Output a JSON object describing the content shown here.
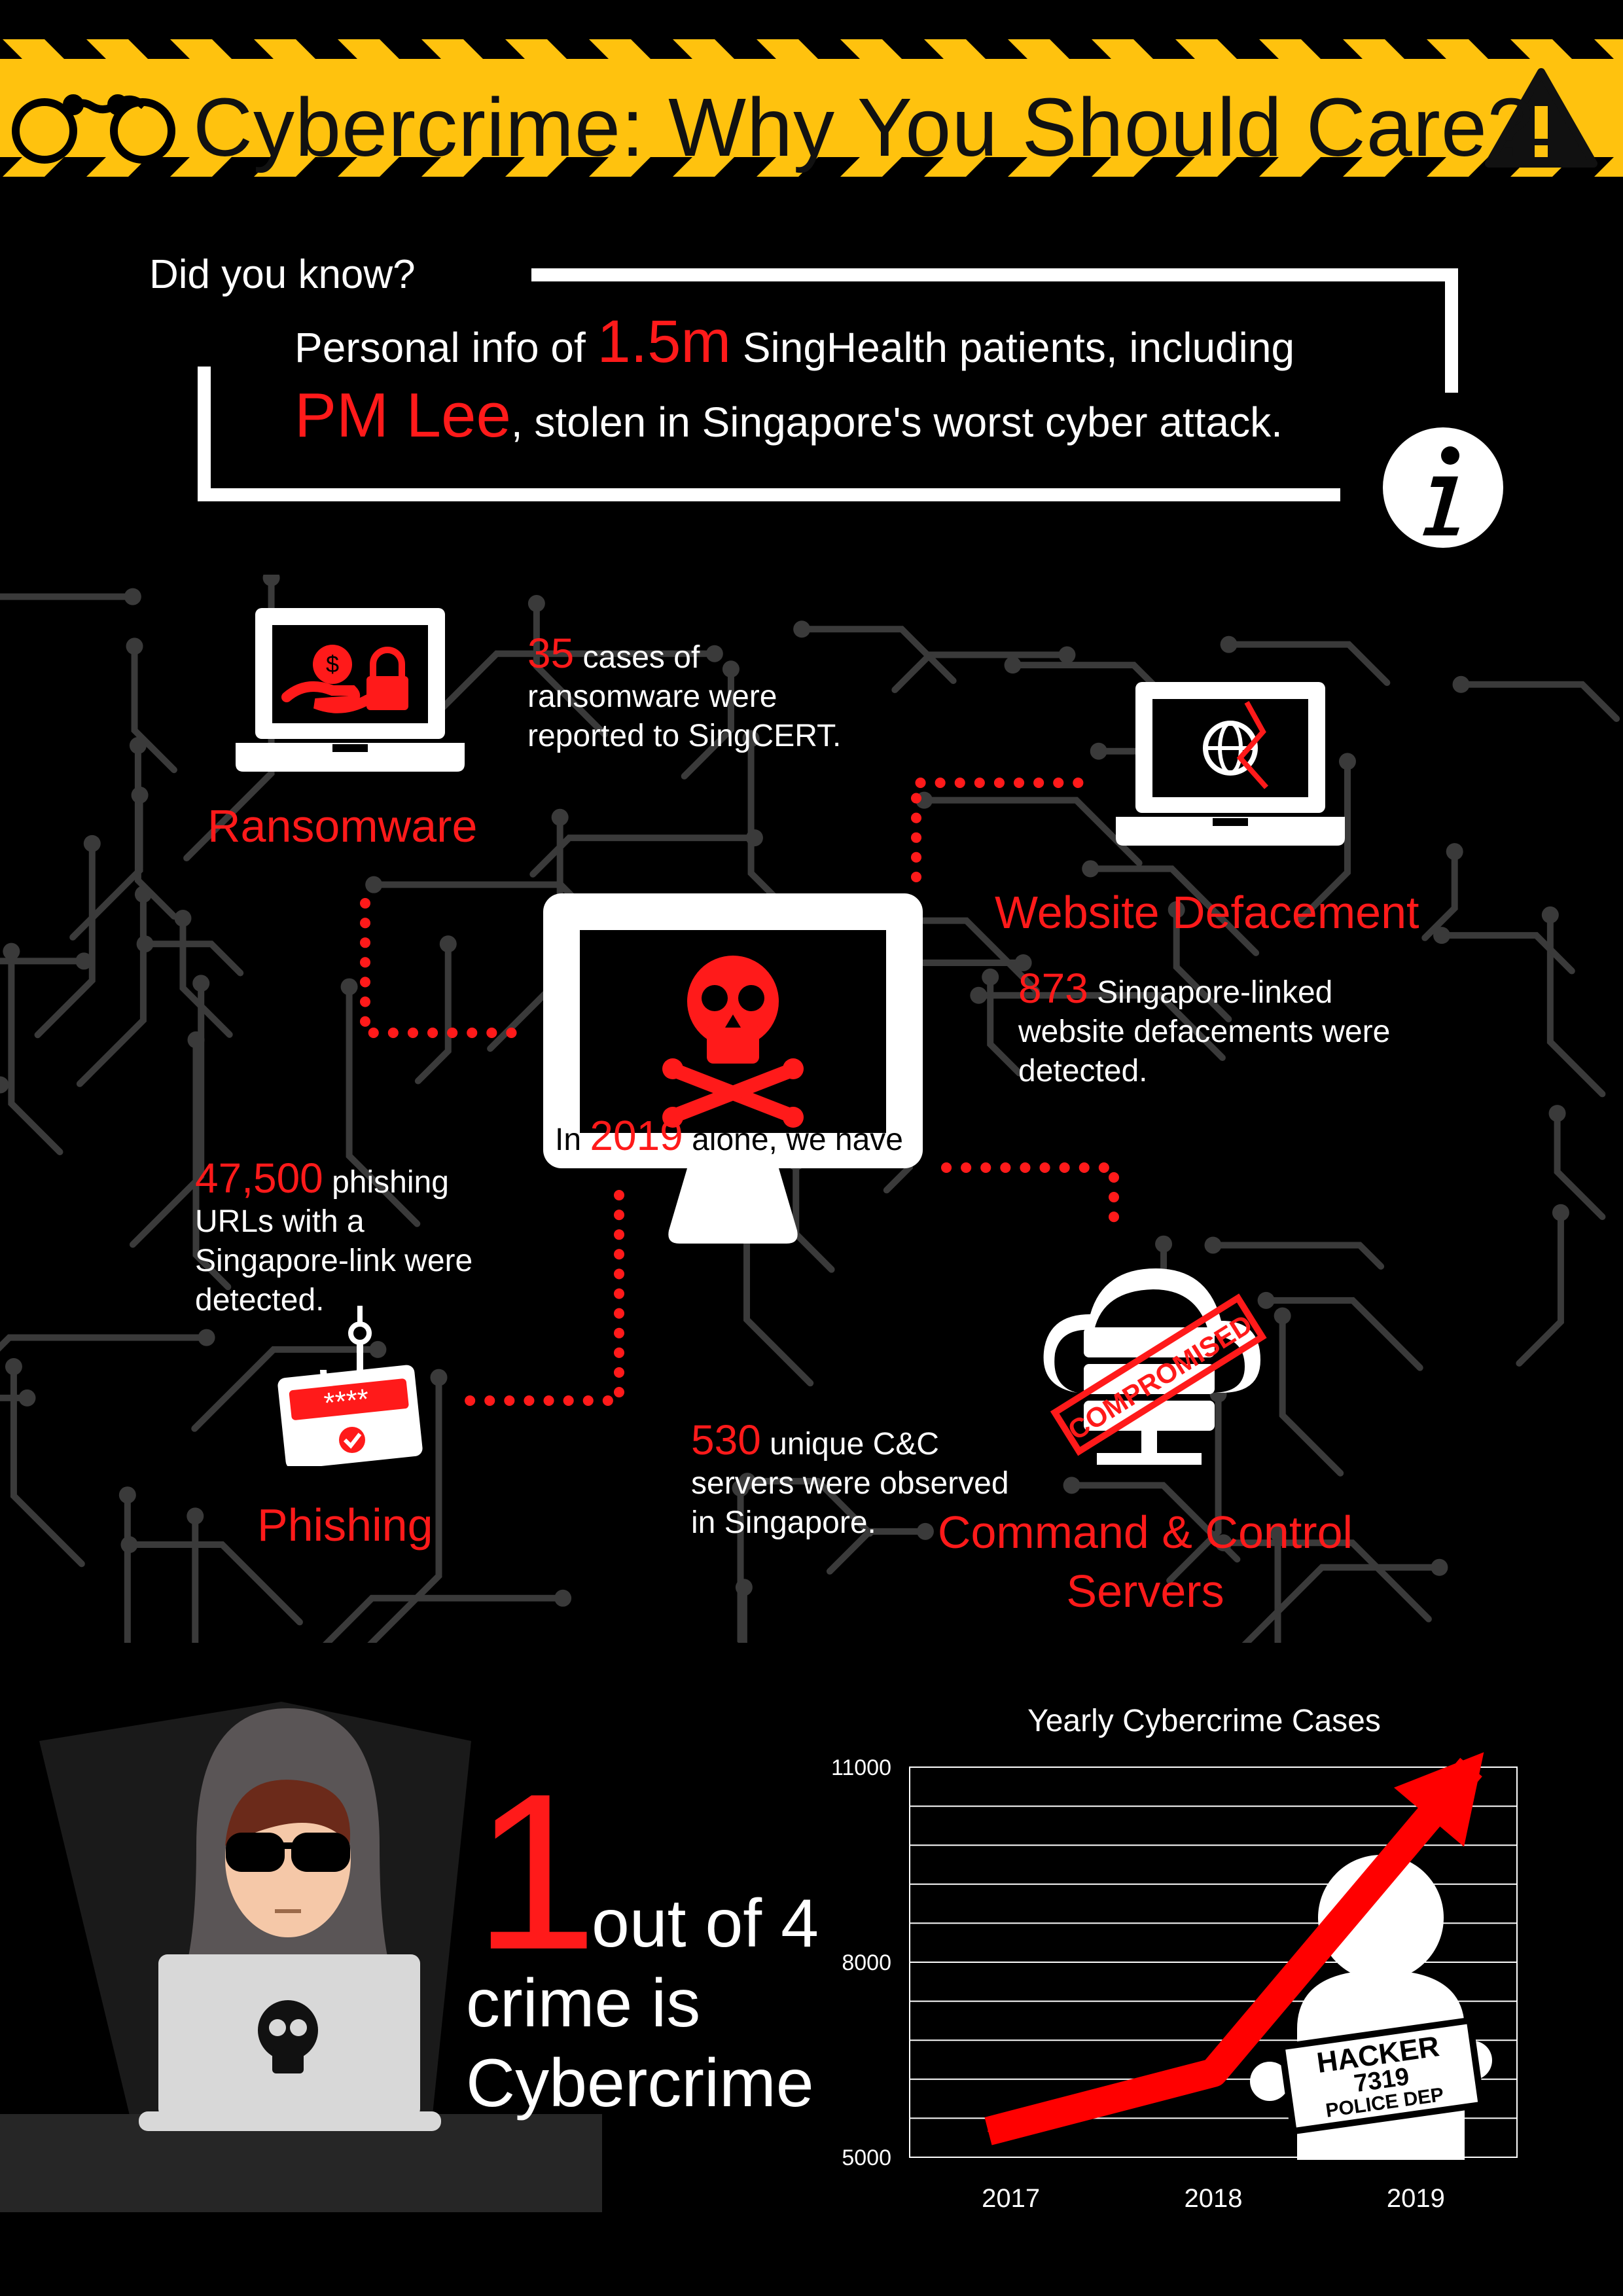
{
  "header": {
    "title": "Cybercrime: Why You Should Care?",
    "icons": [
      "handcuffs-icon",
      "warning-icon"
    ],
    "stripe_color": "#ffc20e"
  },
  "did_you_know": {
    "heading": "Did you know?",
    "line1_pre": "Personal info of ",
    "line1_num": "1.5m",
    "line1_post": " SingHealth patients, including",
    "line2_name": "PM Lee",
    "line2_post": ", stolen in Singapore's worst cyber attack.",
    "icon": "info-icon"
  },
  "center": {
    "pre": "In ",
    "year": "2019",
    "post": " alone, we have",
    "icon": "skull-monitor-icon"
  },
  "ransomware": {
    "label": "Ransomware",
    "num": "35",
    "text1": " cases of",
    "text2": "ransomware were",
    "text3": "reported to SingCERT.",
    "icon": "ransomware-laptop-icon"
  },
  "defacement": {
    "label": "Website Defacement",
    "num": "873",
    "text1": " Singapore-linked",
    "text2": "website defacements were",
    "text3": "detected.",
    "icon": "globe-laptop-icon"
  },
  "phishing": {
    "label": "Phishing",
    "num": "47,500",
    "text1": " phishing",
    "text2": "URLs with a",
    "text3": "Singapore-link were",
    "text4": "detected.",
    "icon": "phishing-hook-icon"
  },
  "cnc": {
    "label1": "Command & Control",
    "label2": "Servers",
    "num": "530",
    "text1": " unique C&C",
    "text2": "servers were observed",
    "text3": "in Singapore.",
    "stamp": "COMPROMISED",
    "icon": "cloud-server-icon"
  },
  "crime_ratio": {
    "big": "1",
    "text1": "out of 4",
    "text2": "crime is",
    "text3": "Cybercrime",
    "icon": "hacker-laptop-icon"
  },
  "chart_data": {
    "type": "line",
    "title": "Yearly Cybercrime Cases",
    "categories": [
      "2017",
      "2018",
      "2019"
    ],
    "y_ticks": [
      "11000",
      "8000",
      "5000"
    ],
    "ylim": [
      5000,
      11000
    ],
    "series": [
      {
        "values": [
          5400,
          6300,
          11000
        ]
      }
    ],
    "grid": true,
    "placard": {
      "line1": "HACKER",
      "line2": "7319",
      "line3": "POLICE DEP"
    },
    "arrow_color": "#ff0000"
  },
  "colors": {
    "accent": "#ff1a1a",
    "yellow": "#ffc20e",
    "circuit": "#3a3a3a"
  }
}
